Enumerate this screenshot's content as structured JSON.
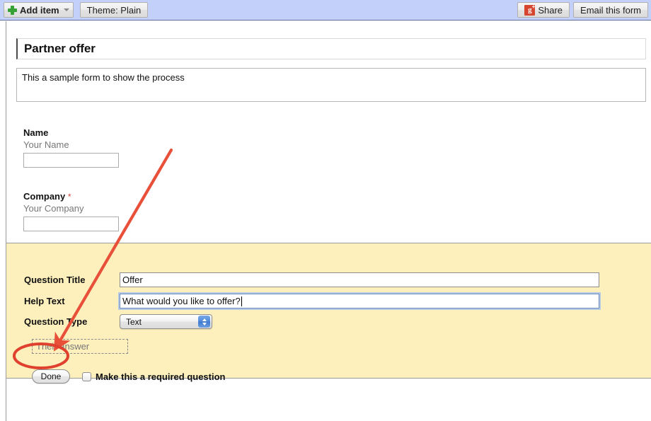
{
  "toolbar": {
    "add_item_label": "Add item",
    "add_item_icon": "plus-icon",
    "add_item_caret_icon": "chevron-down-icon",
    "theme_label": "Theme:  Plain",
    "share_label": "Share",
    "share_icon": "google-plus-icon",
    "share_icon_letter": "g",
    "share_icon_plus": "+",
    "email_form_label": "Email this form",
    "background_color": "#c3d1fa"
  },
  "form": {
    "title": "Partner offer",
    "description": "This a sample form to show the process",
    "questions": [
      {
        "label": "Name",
        "required_marker": "",
        "help_text": "Your Name",
        "input_value": ""
      },
      {
        "label": "Company",
        "required_marker": "*",
        "help_text": "Your Company",
        "input_value": ""
      }
    ]
  },
  "editor": {
    "panel_color": "#fdf0bd",
    "question_title_label": "Question Title",
    "question_title_value": "Offer",
    "help_text_label": "Help Text",
    "help_text_value": "What would you like to offer?",
    "question_type_label": "Question Type",
    "question_type_value": "Text",
    "question_type_options": [
      "Text"
    ],
    "answer_placeholder": "Their answer",
    "done_label": "Done",
    "required_checkbox_label": "Make this a required question",
    "required_checked": false
  },
  "annotations": {
    "arrow_color": "#e8503a",
    "highlight_color": "#e0402e",
    "arrow_name": "red-arrow-annotation",
    "ellipse_name": "red-ellipse-highlight"
  }
}
